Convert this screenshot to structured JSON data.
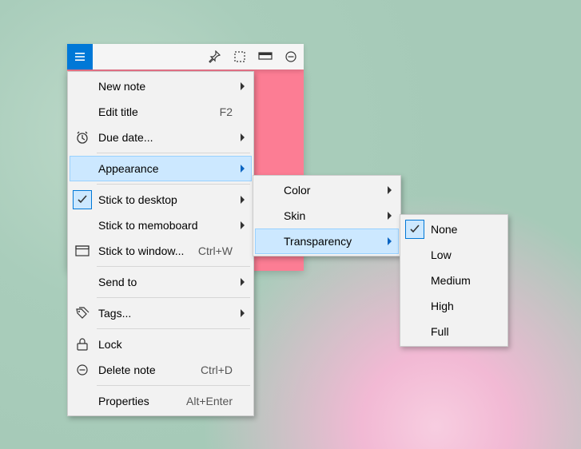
{
  "toolbar": {
    "icons": [
      "menu",
      "pin",
      "selection",
      "window",
      "minimize"
    ]
  },
  "menu": {
    "items": [
      {
        "label": "New note",
        "accel": "",
        "icon": "",
        "submenu": true
      },
      {
        "label": "Edit title",
        "accel": "F2",
        "icon": "",
        "submenu": false
      },
      {
        "label": "Due date...",
        "accel": "",
        "icon": "alarm",
        "submenu": true
      },
      {
        "label": "Appearance",
        "accel": "",
        "icon": "",
        "submenu": true,
        "highlight": true
      },
      {
        "label": "Stick to desktop",
        "accel": "",
        "icon": "check",
        "submenu": true
      },
      {
        "label": "Stick to memoboard",
        "accel": "",
        "icon": "",
        "submenu": true
      },
      {
        "label": "Stick to window...",
        "accel": "Ctrl+W",
        "icon": "window",
        "submenu": false
      },
      {
        "label": "Send to",
        "accel": "",
        "icon": "",
        "submenu": true
      },
      {
        "label": "Tags...",
        "accel": "",
        "icon": "tags",
        "submenu": true
      },
      {
        "label": "Lock",
        "accel": "",
        "icon": "lock",
        "submenu": false
      },
      {
        "label": "Delete note",
        "accel": "Ctrl+D",
        "icon": "minus-circle",
        "submenu": false
      },
      {
        "label": "Properties",
        "accel": "Alt+Enter",
        "icon": "",
        "submenu": false
      }
    ]
  },
  "submenu_appearance": {
    "items": [
      {
        "label": "Color",
        "submenu": true
      },
      {
        "label": "Skin",
        "submenu": true
      },
      {
        "label": "Transparency",
        "submenu": true,
        "highlight": true
      }
    ]
  },
  "submenu_transparency": {
    "items": [
      {
        "label": "None",
        "checked": true
      },
      {
        "label": "Low"
      },
      {
        "label": "Medium"
      },
      {
        "label": "High"
      },
      {
        "label": "Full"
      }
    ]
  }
}
